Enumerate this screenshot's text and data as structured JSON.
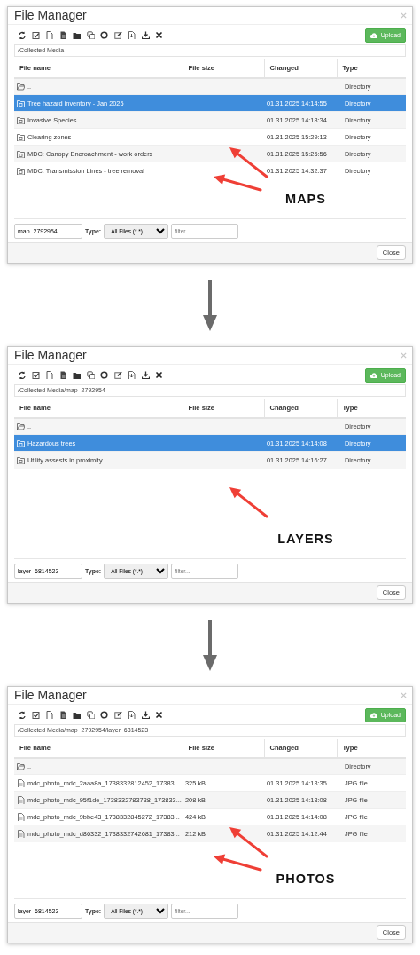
{
  "panels": [
    {
      "title": "File Manager",
      "upload_button": "Upload",
      "path": "/Collected Media",
      "columns": [
        "File name",
        "File size",
        "Changed",
        "Type"
      ],
      "rows": [
        {
          "kind": "parent",
          "name": "..",
          "type": "Directory",
          "selected": false
        },
        {
          "kind": "directory",
          "name": "Tree hazard inventory - Jan 2025",
          "changed": "01.31.2025 14:14:55",
          "type": "Directory",
          "selected": true
        },
        {
          "kind": "directory",
          "name": "Invasive Species",
          "changed": "01.31.2025 14:18:34",
          "type": "Directory",
          "selected": false
        },
        {
          "kind": "directory",
          "name": "Clearing zones",
          "changed": "01.31.2025 15:29:13",
          "type": "Directory",
          "selected": false
        },
        {
          "kind": "directory",
          "name": "MDC: Canopy Encroachment - work orders",
          "changed": "01.31.2025 15:25:56",
          "type": "Directory",
          "selected": false
        },
        {
          "kind": "directory",
          "name": "MDC: Transmission Lines - tree removal",
          "changed": "01.31.2025 14:32:37",
          "type": "Directory",
          "selected": false
        }
      ],
      "filename": "map_2792954",
      "type_label": "Type:",
      "type_select": "All Files (*.*)",
      "filter_placeholder": "filter...",
      "close_button": "Close",
      "annotation": {
        "label": "MAPS",
        "arrows": [
          {
            "kind": "upper"
          },
          {
            "kind": "lower"
          }
        ]
      }
    },
    {
      "title": "File Manager",
      "upload_button": "Upload",
      "path": "/Collected Media/map_2792954",
      "columns": [
        "File name",
        "File size",
        "Changed",
        "Type"
      ],
      "rows": [
        {
          "kind": "parent",
          "name": "..",
          "type": "Directory",
          "selected": false
        },
        {
          "kind": "directory",
          "name": "Hazardous trees",
          "changed": "01.31.2025 14:14:08",
          "type": "Directory",
          "selected": true
        },
        {
          "kind": "directory",
          "name": "Utility assests in proximity",
          "changed": "01.31.2025 14:16:27",
          "type": "Directory",
          "selected": false
        }
      ],
      "filename": "layer_6814523",
      "type_label": "Type:",
      "type_select": "All Files (*.*)",
      "filter_placeholder": "filter...",
      "close_button": "Close",
      "annotation": {
        "label": "LAYERS",
        "arrows": [
          {
            "kind": "upper"
          }
        ]
      }
    },
    {
      "title": "File Manager",
      "upload_button": "Upload",
      "path": "/Collected Media/map_2792954/layer_6814523",
      "columns": [
        "File name",
        "File size",
        "Changed",
        "Type"
      ],
      "rows": [
        {
          "kind": "parent",
          "name": "..",
          "type": "Directory",
          "selected": false
        },
        {
          "kind": "file",
          "name": "mdc_photo_mdc_2aaa8a_1738332812452_17383...",
          "size": "325 kB",
          "changed": "01.31.2025 14:13:35",
          "type": "JPG file",
          "selected": false
        },
        {
          "kind": "file",
          "name": "mdc_photo_mdc_95f1de_1738332783738_173833...",
          "size": "208 kB",
          "changed": "01.31.2025 14:13:08",
          "type": "JPG file",
          "selected": false
        },
        {
          "kind": "file",
          "name": "mdc_photo_mdc_9bbe43_1738332845272_17383...",
          "size": "424 kB",
          "changed": "01.31.2025 14:14:08",
          "type": "JPG file",
          "selected": false
        },
        {
          "kind": "file",
          "name": "mdc_photo_mdc_d86332_1738332742681_17383...",
          "size": "212 kB",
          "changed": "01.31.2025 14:12:44",
          "type": "JPG file",
          "selected": false
        }
      ],
      "filename": "layer_6814523",
      "type_label": "Type:",
      "type_select": "All Files (*.*)",
      "filter_placeholder": "filter...",
      "close_button": "Close",
      "annotation": {
        "label": "PHOTOS",
        "arrows": [
          {
            "kind": "upper"
          },
          {
            "kind": "lower"
          }
        ]
      }
    }
  ]
}
